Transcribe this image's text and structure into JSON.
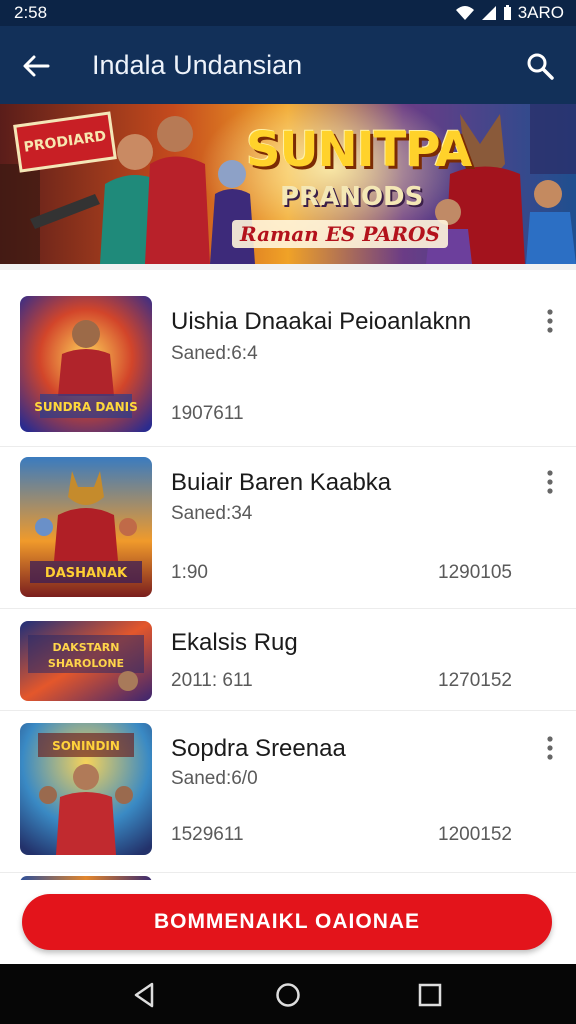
{
  "status": {
    "time": "2:58",
    "battery_text": "3ARO"
  },
  "appbar": {
    "title": "Indala Undansian",
    "back_icon": "back-arrow-icon",
    "search_icon": "search-icon"
  },
  "banner": {
    "sign_text": "PRODIARD",
    "title": "SUNITPA",
    "subtitle": "PRANODS",
    "tagline": "Raman ES PAROS"
  },
  "items": [
    {
      "name": "Uishia Dnaakai Peioanlaknn",
      "sub": "Saned:6:4",
      "meta": "1907611",
      "meta2": "",
      "thumb_text": "SUNDRA DANIS"
    },
    {
      "name": "Buiair Baren Kaabka",
      "sub": "Saned:34",
      "meta": "1:90",
      "meta2": "1290105",
      "thumb_text": "DASHANAK"
    },
    {
      "name": "Ekalsis Rug",
      "sub": "",
      "meta": "2011: 611",
      "meta2": "1270152",
      "thumb_text": "DAKSTARN SHAROLONE"
    },
    {
      "name": "Sopdra Sreenaa",
      "sub": "Saned:6/0",
      "meta": "1529611",
      "meta2": "1200152",
      "thumb_text": "SONINDIN"
    }
  ],
  "cta": {
    "label": "BOMMENAIKL OAIONAE"
  },
  "colors": {
    "appbar": "#123059",
    "statusbar": "#0c2446",
    "accent": "#e3141b"
  }
}
